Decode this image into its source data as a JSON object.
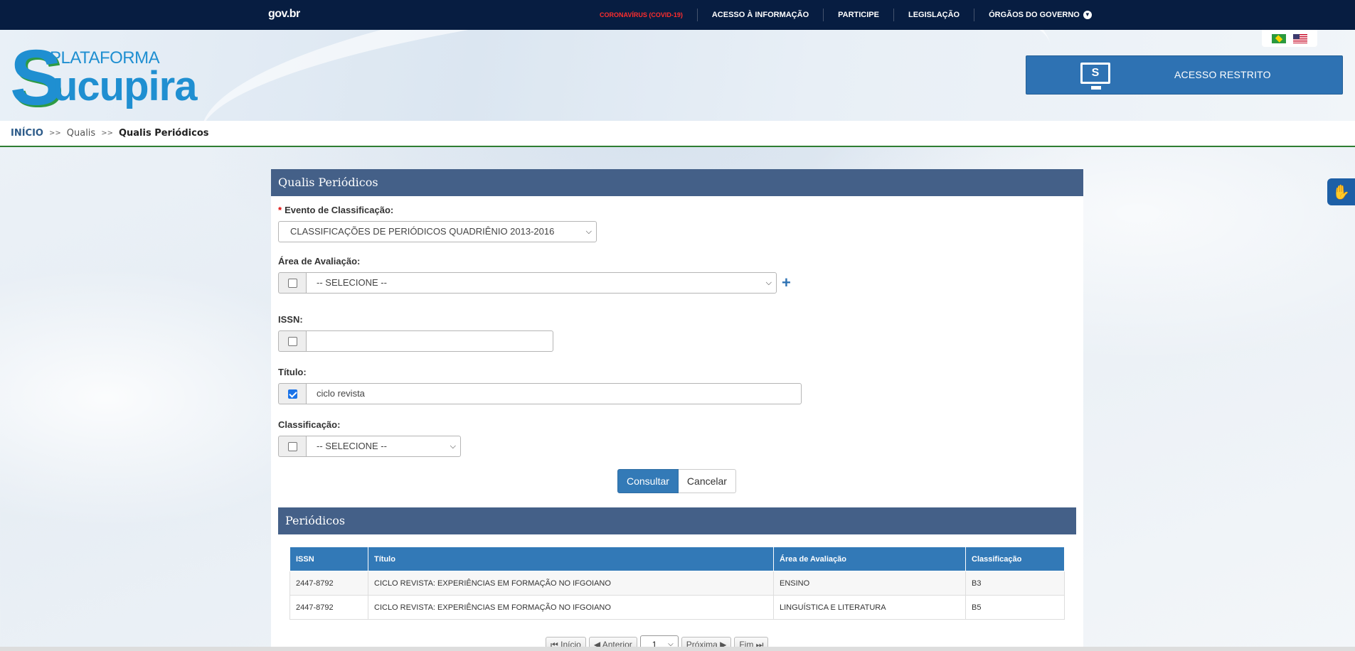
{
  "gov_bar": {
    "logo": "gov.br",
    "menu": [
      "CORONAVÍRUS (COVID-19)",
      "ACESSO À INFORMAÇÃO",
      "PARTICIPE",
      "LEGISLAÇÃO",
      "ÓRGÃOS DO GOVERNO"
    ],
    "chevron_icon": "chevron-down-icon"
  },
  "header": {
    "logo_initial": "S",
    "logo_top": "PLATAFORMA",
    "logo_name": "ucupira",
    "restricted_label": "ACESSO RESTRITO",
    "restricted_icon": "S"
  },
  "breadcrumb": {
    "home": "INÍCIO",
    "separator": ">>",
    "middle": "Qualis",
    "current": "Qualis Periódicos"
  },
  "form": {
    "title": "Qualis Periódicos",
    "required_mark": "*",
    "evento_label": "Evento de Classificação:",
    "evento_value": "CLASSIFICAÇÕES DE PERIÓDICOS QUADRIÊNIO 2013-2016",
    "area_label": "Área de Avaliação:",
    "area_value": "-- SELECIONE --",
    "issn_label": "ISSN:",
    "issn_value": "",
    "titulo_label": "Título:",
    "titulo_value": "ciclo revista",
    "classificacao_label": "Classificação:",
    "classificacao_value": "-- SELECIONE --",
    "submit_label": "Consultar",
    "cancel_label": "Cancelar"
  },
  "results": {
    "title": "Periódicos",
    "columns": [
      "ISSN",
      "Título",
      "Área de Avaliação",
      "Classificação"
    ],
    "rows": [
      [
        "2447-8792",
        "CICLO REVISTA: EXPERIÊNCIAS EM FORMAÇÃO NO IFGOIANO",
        "ENSINO",
        "B3"
      ],
      [
        "2447-8792",
        "CICLO REVISTA: EXPERIÊNCIAS EM FORMAÇÃO NO IFGOIANO",
        "LINGUÍSTICA E LITERATURA",
        "B5"
      ]
    ]
  },
  "pager": {
    "first": "Início",
    "prev": "Anterior",
    "page": "1",
    "next": "Próxima",
    "last": "Fim"
  },
  "colors": {
    "gov_bar": "#071d41",
    "panel_header": "#446088",
    "table_header": "#3279b7",
    "primary_button": "#337ab7"
  }
}
